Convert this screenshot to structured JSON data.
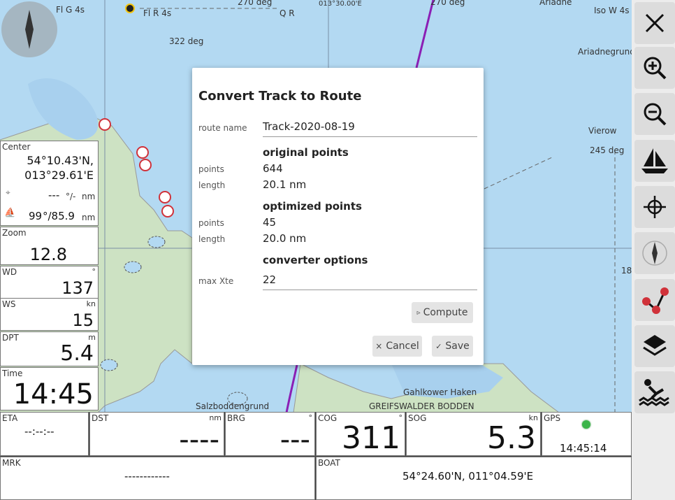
{
  "map": {
    "labels": {
      "fl_g": "Fl G 4s",
      "fl_r": "Fl R 4s",
      "q_r": "Q R",
      "iso_w": "Iso W 4s",
      "ariadne": "Ariadne",
      "ariadnegrund": "Ariadnegrund",
      "vierow": "Vierow",
      "deg322": "322 deg",
      "deg270a": "270 deg",
      "deg270b": "270 deg",
      "deg245": "245 deg",
      "lon": "013°30.00'E",
      "gahlkower": "Gahlkower Haken",
      "greifswalder": "GREIFSWALDER BODDEN",
      "salzbodden": "Salzboddengrund",
      "n18": "18"
    }
  },
  "left_widgets": {
    "center": {
      "label": "Center",
      "lat": "54°10.43'N,",
      "lon": "013°29.61'E",
      "wp_value": "---",
      "wp_unit1": "°/-",
      "wp_unit2": "nm",
      "boat_value": "99",
      "boat_unit1": "°/85.9",
      "boat_unit2": "nm"
    },
    "zoom": {
      "label": "Zoom",
      "value": "12.8"
    },
    "wd": {
      "label": "WD",
      "unit": "°",
      "value": "137"
    },
    "ws": {
      "label": "WS",
      "unit": "kn",
      "value": "15"
    },
    "dpt": {
      "label": "DPT",
      "unit": "m",
      "value": "5.4"
    },
    "time": {
      "label": "Time",
      "value": "14:45"
    }
  },
  "bottom_widgets": {
    "eta": {
      "label": "ETA",
      "value": "--:--:--"
    },
    "dst": {
      "label": "DST",
      "unit": "nm",
      "value": "----"
    },
    "brg": {
      "label": "BRG",
      "unit": "°",
      "value": "---"
    },
    "cog": {
      "label": "COG",
      "unit": "°",
      "value": "311"
    },
    "sog": {
      "label": "SOG",
      "unit": "kn",
      "value": "5.3"
    },
    "gps": {
      "label": "GPS",
      "value": "14:45:14",
      "status_color": "#3cb54a"
    },
    "mrk": {
      "label": "MRK",
      "value": "------------"
    },
    "boat": {
      "label": "BOAT",
      "value": "54°24.60'N, 011°04.59'E"
    }
  },
  "right_bar": {
    "buttons": [
      "close-icon",
      "zoom-in-icon",
      "zoom-out-icon",
      "boat-icon",
      "center-crosshair-icon",
      "compass-north-icon",
      "route-icon",
      "layers-icon",
      "anchor-watch-icon"
    ]
  },
  "dialog": {
    "title": "Convert Track to Route",
    "route_name_label": "route name",
    "route_name_value": "Track-2020-08-19",
    "original_heading": "original points",
    "orig_points_label": "points",
    "orig_points_value": "644",
    "orig_length_label": "length",
    "orig_length_value": "20.1 nm",
    "optimized_heading": "optimized points",
    "opt_points_label": "points",
    "opt_points_value": "45",
    "opt_length_label": "length",
    "opt_length_value": "20.0 nm",
    "converter_heading": "converter options",
    "max_xte_label": "max Xte",
    "max_xte_value": "22",
    "compute_label": "Compute",
    "cancel_label": "Cancel",
    "save_label": "Save"
  },
  "colors": {
    "track": "#8b1fb5",
    "accent_red": "#d0323a",
    "sea": "#b3d9f2",
    "land": "#cde2c3"
  }
}
